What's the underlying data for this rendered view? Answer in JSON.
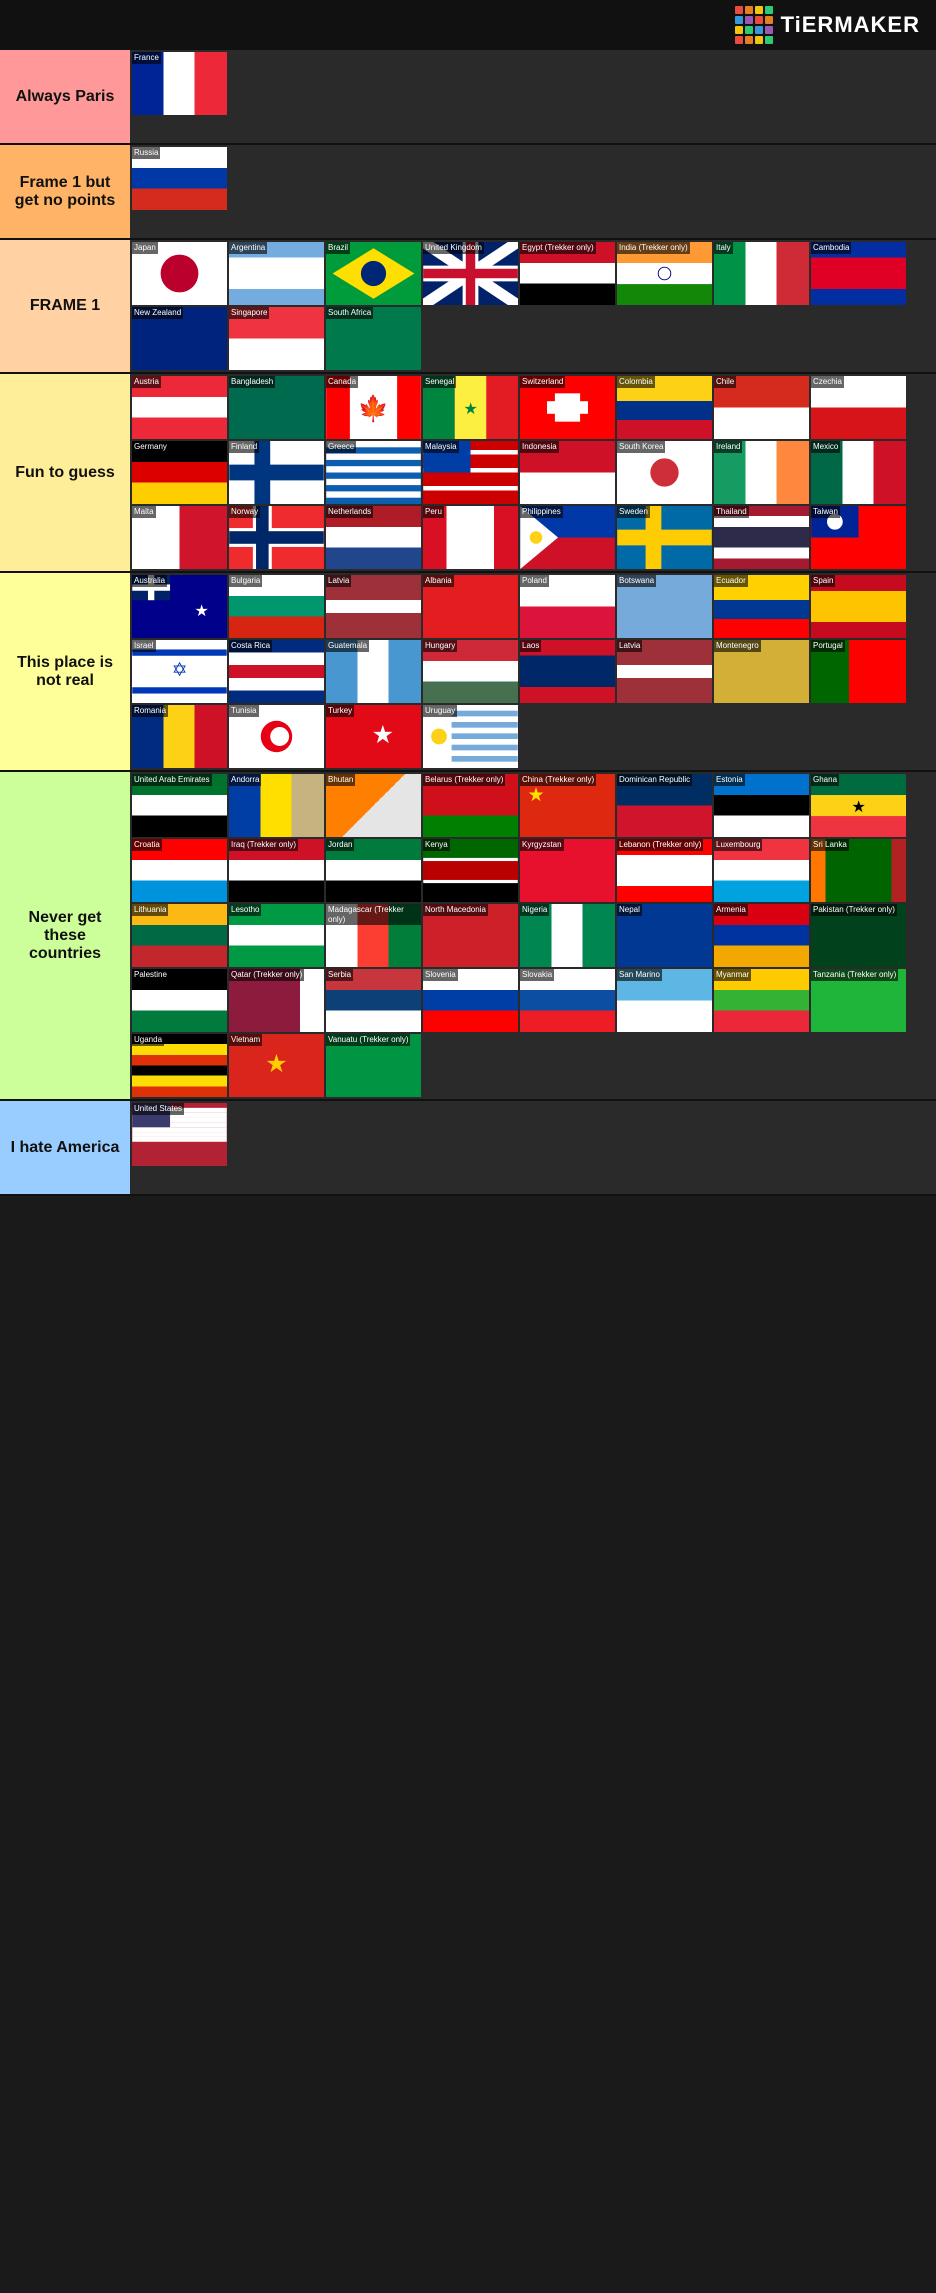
{
  "header": {
    "logo_text": "TiERMAKER",
    "logo_colors": [
      "#e74c3c",
      "#e67e22",
      "#f1c40f",
      "#2ecc71",
      "#3498db",
      "#9b59b6",
      "#e74c3c",
      "#e67e22",
      "#f1c40f",
      "#2ecc71",
      "#3498db",
      "#9b59b6",
      "#e74c3c",
      "#e67e22",
      "#f1c40f",
      "#2ecc71"
    ]
  },
  "tiers": [
    {
      "id": "always-paris",
      "label": "Always Paris",
      "color": "#ff9999",
      "flags": [
        {
          "name": "France",
          "css": "flag-france"
        }
      ]
    },
    {
      "id": "frame1-no-points",
      "label": "Frame 1 but get no points",
      "color": "#ffb366",
      "flags": [
        {
          "name": "Russia",
          "css": "flag-russia"
        }
      ]
    },
    {
      "id": "frame1",
      "label": "FRAME 1",
      "color": "#ffd1a3",
      "flags": [
        {
          "name": "Japan",
          "css": "flag-japan"
        },
        {
          "name": "Argentina",
          "css": "flag-argentina"
        },
        {
          "name": "Brazil",
          "css": "flag-brazil"
        },
        {
          "name": "United Kingdom",
          "css": "flag-uk"
        },
        {
          "name": "Egypt (Trekker only)",
          "css": "flag-egypt"
        },
        {
          "name": "India (Trekker only)",
          "css": "flag-india"
        },
        {
          "name": "Italy",
          "css": "flag-italy"
        },
        {
          "name": "Cambodia",
          "css": "flag-cambodia"
        },
        {
          "name": "New Zealand",
          "css": "flag-nz"
        },
        {
          "name": "Singapore",
          "css": "flag-singapore"
        },
        {
          "name": "South Africa",
          "css": "flag-south-africa"
        }
      ]
    },
    {
      "id": "fun-to-guess",
      "label": "Fun to guess",
      "color": "#ffee99",
      "flags": [
        {
          "name": "Austria",
          "css": "flag-austria"
        },
        {
          "name": "Bangladesh",
          "css": "flag-bangladesh"
        },
        {
          "name": "Canada",
          "css": "flag-canada"
        },
        {
          "name": "Senegal",
          "css": "flag-senegal"
        },
        {
          "name": "Switzerland",
          "css": "flag-switzerland"
        },
        {
          "name": "Colombia",
          "css": "flag-colombia"
        },
        {
          "name": "Chile",
          "css": "flag-chile"
        },
        {
          "name": "Czechia",
          "css": "flag-czechia"
        },
        {
          "name": "Germany",
          "css": "flag-germany"
        },
        {
          "name": "Finland",
          "css": "flag-finland"
        },
        {
          "name": "Greece",
          "css": "flag-greece"
        },
        {
          "name": "Malaysia",
          "css": "flag-malaysia"
        },
        {
          "name": "Indonesia",
          "css": "flag-indonesia"
        },
        {
          "name": "South Korea",
          "css": "flag-south-korea"
        },
        {
          "name": "Ireland",
          "css": "flag-ireland"
        },
        {
          "name": "Mexico",
          "css": "flag-mexico"
        },
        {
          "name": "Malta",
          "css": "flag-malta"
        },
        {
          "name": "Norway",
          "css": "flag-norway"
        },
        {
          "name": "Netherlands",
          "css": "flag-netherlands"
        },
        {
          "name": "Peru",
          "css": "flag-peru"
        },
        {
          "name": "Philippines",
          "css": "flag-philippines"
        },
        {
          "name": "Sweden",
          "css": "flag-sweden"
        },
        {
          "name": "Thailand",
          "css": "flag-thailand"
        },
        {
          "name": "Taiwan",
          "css": "flag-taiwan"
        }
      ]
    },
    {
      "id": "not-real",
      "label": "This place is not real",
      "color": "#ffff99",
      "flags": [
        {
          "name": "Australia",
          "css": "flag-australia"
        },
        {
          "name": "Bulgaria",
          "css": "flag-bulgaria"
        },
        {
          "name": "Latvia",
          "css": "flag-latvia"
        },
        {
          "name": "Albania",
          "css": "flag-albania"
        },
        {
          "name": "Poland",
          "css": "flag-poland"
        },
        {
          "name": "Botswana",
          "css": "flag-botswana"
        },
        {
          "name": "Ecuador",
          "css": "flag-ecuador"
        },
        {
          "name": "Spain",
          "css": "flag-spain"
        },
        {
          "name": "Israel",
          "css": "flag-israel"
        },
        {
          "name": "Costa Rica",
          "css": "flag-costa-rica"
        },
        {
          "name": "Guatemala",
          "css": "flag-guatemala"
        },
        {
          "name": "Hungary",
          "css": "flag-hungary"
        },
        {
          "name": "Laos",
          "css": "flag-laos"
        },
        {
          "name": "Latvia",
          "css": "flag-latvia2"
        },
        {
          "name": "Montenegro",
          "css": "flag-montenegro"
        },
        {
          "name": "Portugal",
          "css": "flag-portugal"
        },
        {
          "name": "Romania",
          "css": "flag-romania"
        },
        {
          "name": "Tunisia",
          "css": "flag-tunisia"
        },
        {
          "name": "Turkey",
          "css": "flag-turkey"
        },
        {
          "name": "Uruguay",
          "css": "flag-uruguay"
        }
      ]
    },
    {
      "id": "never-get",
      "label": "Never get these countries",
      "color": "#ccff99",
      "flags": [
        {
          "name": "United Arab Emirates",
          "css": "flag-uae"
        },
        {
          "name": "Andorra",
          "css": "flag-andorra"
        },
        {
          "name": "Bhutan",
          "css": "flag-bhutan"
        },
        {
          "name": "Belarus (Trekker only)",
          "css": "flag-belarus"
        },
        {
          "name": "China (Trekker only)",
          "css": "flag-china"
        },
        {
          "name": "Dominican Republic",
          "css": "flag-dom-rep"
        },
        {
          "name": "Estonia",
          "css": "flag-estonia"
        },
        {
          "name": "Ghana",
          "css": "flag-ghana"
        },
        {
          "name": "Croatia",
          "css": "flag-croatia"
        },
        {
          "name": "Iraq (Trekker only)",
          "css": "flag-iraq"
        },
        {
          "name": "Jordan",
          "css": "flag-jordan"
        },
        {
          "name": "Kenya",
          "css": "flag-kenya"
        },
        {
          "name": "Kyrgyzstan",
          "css": "flag-kyrgyzstan"
        },
        {
          "name": "Lebanon (Trekker only)",
          "css": "flag-lebanon"
        },
        {
          "name": "Luxembourg",
          "css": "flag-luxembourg"
        },
        {
          "name": "Sri Lanka",
          "css": "flag-sri-lanka"
        },
        {
          "name": "Lithuania",
          "css": "flag-lithuania"
        },
        {
          "name": "Lesotho",
          "css": "flag-lesotho"
        },
        {
          "name": "Madagascar (Trekker only)",
          "css": "flag-madagascar"
        },
        {
          "name": "North Macedonia",
          "css": "flag-n-macedonia"
        },
        {
          "name": "Nigeria",
          "css": "flag-nigeria"
        },
        {
          "name": "Nepal",
          "css": "flag-nepal"
        },
        {
          "name": "Armenia",
          "css": "flag-armenia"
        },
        {
          "name": "Pakistan (Trekker only)",
          "css": "flag-pakistan"
        },
        {
          "name": "Palestine",
          "css": "flag-palestine"
        },
        {
          "name": "Qatar (Trekker only)",
          "css": "flag-qatar"
        },
        {
          "name": "Serbia",
          "css": "flag-serbia"
        },
        {
          "name": "Slovenia",
          "css": "flag-slovenia"
        },
        {
          "name": "Slovakia",
          "css": "flag-slovakia"
        },
        {
          "name": "San Marino",
          "css": "flag-san-marino"
        },
        {
          "name": "Myanmar",
          "css": "flag-myanmar"
        },
        {
          "name": "Tanzania (Trekker only)",
          "css": "flag-tanzania"
        },
        {
          "name": "Uganda",
          "css": "flag-uganda"
        },
        {
          "name": "Vietnam",
          "css": "flag-vietnam"
        },
        {
          "name": "Vanuatu (Trekker only)",
          "css": "flag-vanuatu"
        }
      ]
    },
    {
      "id": "hate-america",
      "label": "I hate America",
      "color": "#99ccff",
      "flags": [
        {
          "name": "United States",
          "css": "flag-usa"
        }
      ]
    }
  ]
}
